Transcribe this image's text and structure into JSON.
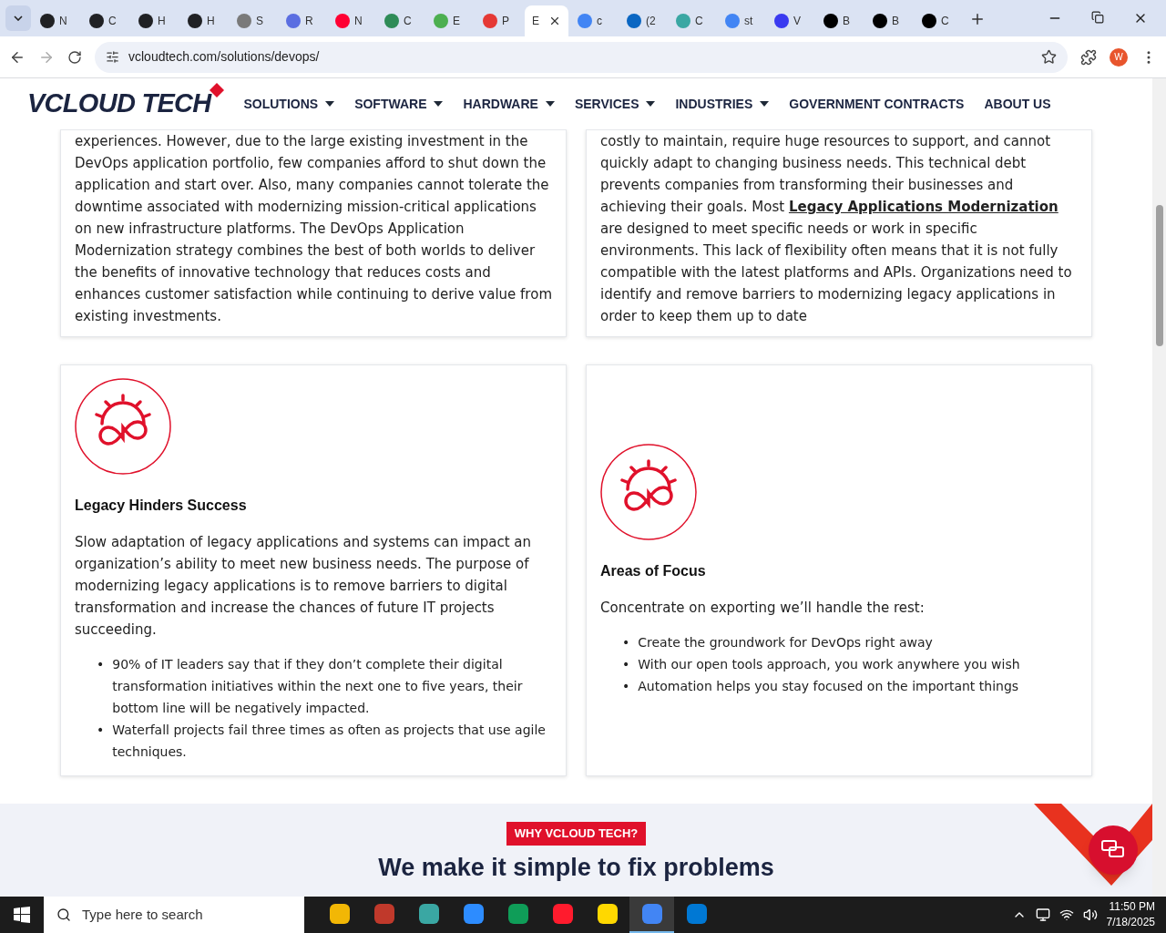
{
  "browser": {
    "tabs": [
      {
        "title": "N",
        "selected": false,
        "color": "#202124"
      },
      {
        "title": "C",
        "selected": false,
        "color": "#202124"
      },
      {
        "title": "H",
        "selected": false,
        "color": "#202124"
      },
      {
        "title": "H",
        "selected": false,
        "color": "#202124"
      },
      {
        "title": "S",
        "selected": false,
        "color": "#7a7a7a"
      },
      {
        "title": "R",
        "selected": false,
        "color": "#5b6ee1"
      },
      {
        "title": "N",
        "selected": false,
        "color": "#ff0033"
      },
      {
        "title": "C",
        "selected": false,
        "color": "#2e8b57"
      },
      {
        "title": "E",
        "selected": false,
        "color": "#4caf50"
      },
      {
        "title": "P",
        "selected": false,
        "color": "#e53935"
      },
      {
        "title": "E",
        "selected": true
      },
      {
        "title": "c",
        "selected": false,
        "color": "#4285f4"
      },
      {
        "title": "(2",
        "selected": false,
        "color": "#0a66c2"
      },
      {
        "title": "C",
        "selected": false,
        "color": "#3aa7a3"
      },
      {
        "title": "st",
        "selected": false,
        "color": "#4285f4"
      },
      {
        "title": "V",
        "selected": false,
        "color": "#3a3af0"
      },
      {
        "title": "B",
        "selected": false,
        "color": "#000000"
      },
      {
        "title": "B",
        "selected": false,
        "color": "#000000"
      },
      {
        "title": "C",
        "selected": false,
        "color": "#000000"
      }
    ],
    "url": "vcloudtech.com/solutions/devops/",
    "profile": "W"
  },
  "site": {
    "logo": "VCLOUD TECH",
    "nav": [
      {
        "label": "SOLUTIONS",
        "dropdown": true
      },
      {
        "label": "SOFTWARE",
        "dropdown": true
      },
      {
        "label": "HARDWARE",
        "dropdown": true
      },
      {
        "label": "SERVICES",
        "dropdown": true
      },
      {
        "label": "INDUSTRIES",
        "dropdown": true
      },
      {
        "label": "GOVERNMENT CONTRACTS",
        "dropdown": false
      },
      {
        "label": "ABOUT US",
        "dropdown": false
      }
    ]
  },
  "cards": [
    {
      "kind": "text",
      "paragraph": "experiences. However, due to the large existing investment in the DevOps application portfolio, few companies afford to shut down the application and start over. Also, many companies cannot tolerate the downtime associated with modernizing mission-critical applications on new infrastructure platforms. The DevOps Application Modernization strategy combines the best of both worlds to deliver the benefits of innovative technology that reduces costs and enhances customer satisfaction while continuing to derive value from existing investments."
    },
    {
      "kind": "text",
      "paragraph": "costly to maintain, require huge resources to support, and cannot quickly adapt to changing business needs. This technical debt prevents companies from transforming their businesses and achieving their goals. Most **Legacy Applications Modernization** are designed to meet specific needs or work in specific environments. This lack of flexibility often means that it is not fully compatible with the latest platforms and APIs. Organizations need to identify and remove barriers to modernizing legacy applications in order to keep them up to date"
    },
    {
      "kind": "feature",
      "title": "Legacy Hinders Success",
      "paragraph": "Slow adaptation of legacy applications and systems can impact an organization’s ability to meet new business needs. The purpose of modernizing legacy applications is to remove barriers to digital transformation and increase the chances of future IT projects succeeding.",
      "bullet_marker": "•",
      "bullets": [
        "90% of IT leaders say that if they don’t complete their digital transformation initiatives within the next one to five years, their bottom line will be negatively impacted.",
        "Waterfall projects fail three times as often as projects that use agile techniques."
      ]
    },
    {
      "kind": "feature",
      "title": "Areas of Focus",
      "paragraph": "Concentrate on exporting we’ll handle the rest:",
      "bullet_marker": "•",
      "bullets": [
        "Create the groundwork for DevOps right away",
        "With our open tools approach, you work anywhere you wish",
        "Automation helps you stay focused on the important things"
      ]
    }
  ],
  "why": {
    "badge": "WHY VCLOUD TECH?",
    "heading": "We make it simple to fix problems"
  },
  "taskbar": {
    "search_placeholder": "Type here to search",
    "apps": [
      {
        "color": "#f2b705",
        "selected": false
      },
      {
        "color": "#c0392b",
        "selected": false
      },
      {
        "color": "#3aa7a3",
        "selected": false
      },
      {
        "color": "#2d8cff",
        "selected": false
      },
      {
        "color": "#0f9d58",
        "selected": false
      },
      {
        "color": "#ff1b2d",
        "selected": false
      },
      {
        "color": "#ffd800",
        "selected": false
      },
      {
        "color": "#4285f4",
        "selected": true
      },
      {
        "color": "#0078d4",
        "selected": false
      }
    ],
    "time": "11:50 PM",
    "date": "7/18/2025"
  }
}
